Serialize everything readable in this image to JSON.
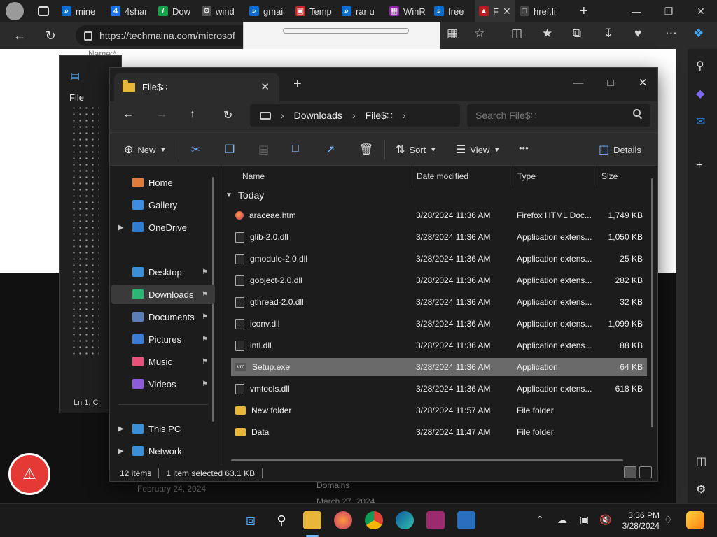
{
  "browser": {
    "tabs": [
      {
        "label": "mine",
        "fav_color": "#0a6ed1",
        "fav": "⌕"
      },
      {
        "label": "4shar",
        "fav_color": "#1b73e8",
        "fav": "4"
      },
      {
        "label": "Dow",
        "fav_color": "#16a34a",
        "fav": "/"
      },
      {
        "label": "wind",
        "fav_color": "#555555",
        "fav": "⚙"
      },
      {
        "label": "gmai",
        "fav_color": "#0a6ed1",
        "fav": "⌕"
      },
      {
        "label": "Temp",
        "fav_color": "#c62828",
        "fav": "▣"
      },
      {
        "label": "rar u",
        "fav_color": "#0a6ed1",
        "fav": "⌕"
      },
      {
        "label": "WinR",
        "fav_color": "#8e24aa",
        "fav": "▦"
      },
      {
        "label": "free",
        "fav_color": "#0a6ed1",
        "fav": "⌕"
      },
      {
        "label": "F",
        "fav_color": "#b71c1c",
        "fav": "▲"
      },
      {
        "label": "href.li",
        "fav_color": "#444444",
        "fav": "□"
      }
    ],
    "url": "https://techmaina.com/microsof",
    "web_labels": {
      "name_label": "Name:*",
      "date1": "February 24, 2024",
      "domains": "Domains",
      "date2": "March 27, 2024"
    }
  },
  "explorer": {
    "tab_title": "File$∷",
    "breadcrumb": [
      "Downloads",
      "File$∷"
    ],
    "search_placeholder": "Search File$∷",
    "toolbar": {
      "new": "New",
      "sort": "Sort",
      "view": "View",
      "details": "Details",
      "more": "•••"
    },
    "sidebar": [
      {
        "label": "Home",
        "color": "#e07b39",
        "pinned": false,
        "expand": false
      },
      {
        "label": "Gallery",
        "color": "#3d8ee0",
        "pinned": false,
        "expand": false
      },
      {
        "label": "OneDrive",
        "color": "#2d7dd2",
        "pinned": false,
        "expand": true
      },
      {
        "label": "Desktop",
        "color": "#3a8fd8",
        "pinned": true,
        "expand": false
      },
      {
        "label": "Downloads",
        "color": "#2bb673",
        "pinned": true,
        "expand": false,
        "selected": true
      },
      {
        "label": "Documents",
        "color": "#5b7fb8",
        "pinned": true,
        "expand": false
      },
      {
        "label": "Pictures",
        "color": "#3a7bd5",
        "pinned": true,
        "expand": false
      },
      {
        "label": "Music",
        "color": "#e8527a",
        "pinned": true,
        "expand": false
      },
      {
        "label": "Videos",
        "color": "#8e5cd8",
        "pinned": true,
        "expand": false
      },
      {
        "label": "This PC",
        "color": "#3a8fd8",
        "pinned": false,
        "expand": true
      },
      {
        "label": "Network",
        "color": "#3a8fd8",
        "pinned": false,
        "expand": true
      }
    ],
    "columns": [
      "Name",
      "Date modified",
      "Type",
      "Size"
    ],
    "group": "Today",
    "files": [
      {
        "name": "araceae.htm",
        "date": "3/28/2024 11:36 AM",
        "type": "Firefox HTML Doc...",
        "size": "1,749 KB",
        "icon": "ff"
      },
      {
        "name": "glib-2.0.dll",
        "date": "3/28/2024 11:36 AM",
        "type": "Application extens...",
        "size": "1,050 KB",
        "icon": "file"
      },
      {
        "name": "gmodule-2.0.dll",
        "date": "3/28/2024 11:36 AM",
        "type": "Application extens...",
        "size": "25 KB",
        "icon": "file"
      },
      {
        "name": "gobject-2.0.dll",
        "date": "3/28/2024 11:36 AM",
        "type": "Application extens...",
        "size": "282 KB",
        "icon": "file"
      },
      {
        "name": "gthread-2.0.dll",
        "date": "3/28/2024 11:36 AM",
        "type": "Application extens...",
        "size": "32 KB",
        "icon": "file"
      },
      {
        "name": "iconv.dll",
        "date": "3/28/2024 11:36 AM",
        "type": "Application extens...",
        "size": "1,099 KB",
        "icon": "file"
      },
      {
        "name": "intl.dll",
        "date": "3/28/2024 11:36 AM",
        "type": "Application extens...",
        "size": "88 KB",
        "icon": "file"
      },
      {
        "name": "Setup.exe",
        "date": "3/28/2024 11:36 AM",
        "type": "Application",
        "size": "64 KB",
        "icon": "vm",
        "selected": true
      },
      {
        "name": "vmtools.dll",
        "date": "3/28/2024 11:36 AM",
        "type": "Application extens...",
        "size": "618 KB",
        "icon": "file"
      },
      {
        "name": "New folder",
        "date": "3/28/2024 11:57 AM",
        "type": "File folder",
        "size": "",
        "icon": "folder"
      },
      {
        "name": "Data",
        "date": "3/28/2024 11:47 AM",
        "type": "File folder",
        "size": "",
        "icon": "folder"
      }
    ],
    "status": {
      "items": "12 items",
      "selected": "1 item selected  63.1 KB"
    }
  },
  "background_window": {
    "menu_file": "File",
    "status": "Ln 1, C"
  },
  "taskbar": {
    "time": "3:36 PM",
    "date": "3/28/2024"
  },
  "colors": {
    "accent": "#6cb8ff",
    "selection": "#6a6a6a",
    "folder": "#e8b73a"
  }
}
